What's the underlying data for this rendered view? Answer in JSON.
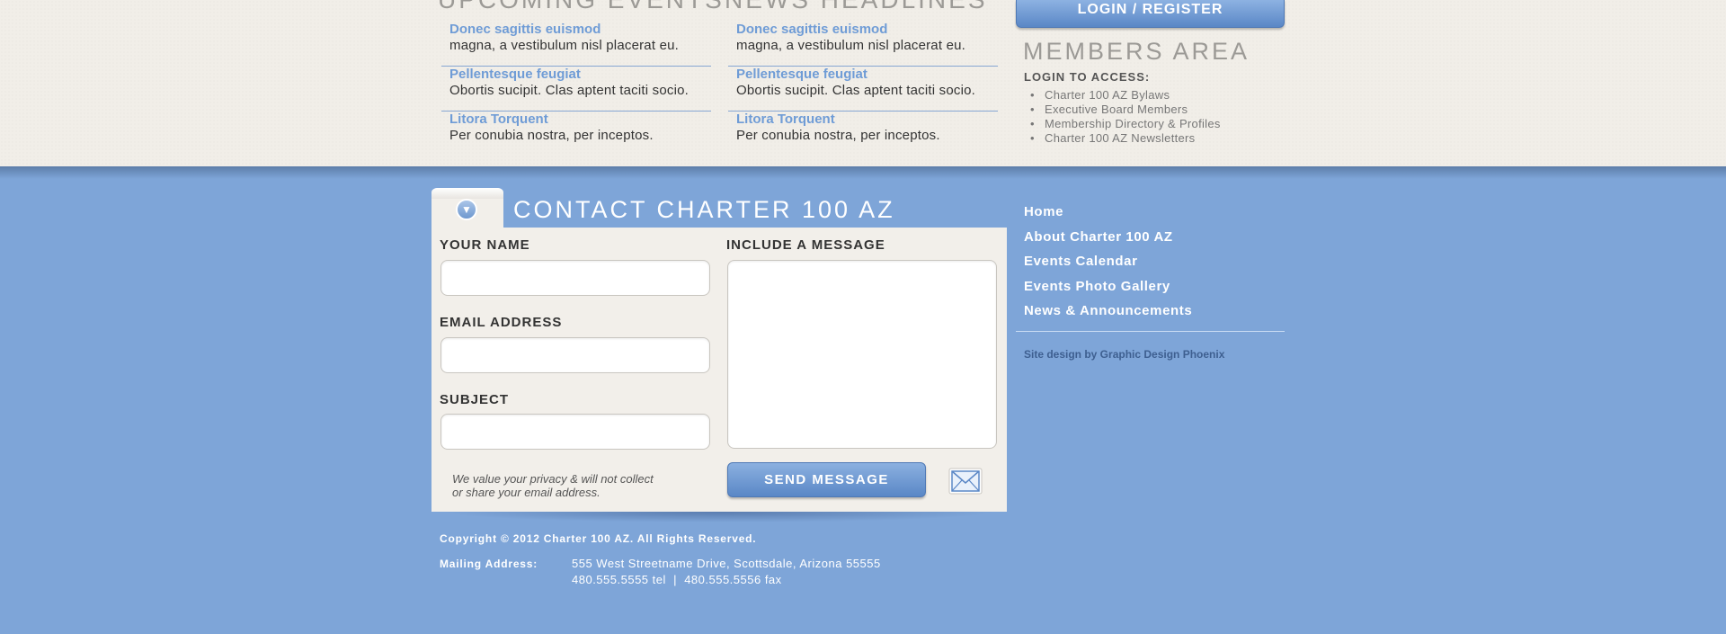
{
  "upcoming_events": {
    "heading": "UPCOMING EVENTS",
    "items": [
      {
        "title": "Donec sagittis euismod",
        "text": "magna, a vestibulum nisl placerat eu."
      },
      {
        "title": "Pellentesque feugiat",
        "text": "Obortis sucipit. Clas aptent taciti socio."
      },
      {
        "title": "Litora Torquent",
        "text": "Per conubia nostra, per inceptos."
      }
    ]
  },
  "news_headlines": {
    "heading": "NEWS HEADLINES",
    "items": [
      {
        "title": "Donec sagittis euismod",
        "text": "magna, a vestibulum nisl placerat eu."
      },
      {
        "title": "Pellentesque feugiat",
        "text": "Obortis sucipit. Clas aptent taciti socio."
      },
      {
        "title": "Litora Torquent",
        "text": "Per conubia nostra, per inceptos."
      }
    ]
  },
  "login_button": "LOGIN / REGISTER",
  "members": {
    "title": "MEMBERS AREA",
    "subtitle": "LOGIN TO ACCESS:",
    "items": [
      "Charter 100 AZ Bylaws",
      "Executive Board Members",
      "Membership Directory & Profiles",
      "Charter 100 AZ Newsletters"
    ]
  },
  "contact": {
    "title": "CONTACT CHARTER 100 AZ",
    "name_label": "YOUR NAME",
    "email_label": "EMAIL ADDRESS",
    "subject_label": "SUBJECT",
    "message_label": "INCLUDE A MESSAGE",
    "privacy_line1": "We value your privacy & will not collect",
    "privacy_line2": "or share your email address.",
    "send_label": "SEND MESSAGE"
  },
  "nav": [
    "Home",
    "About Charter 100 AZ",
    "Events Calendar",
    "Events Photo Gallery",
    "News & Announcements"
  ],
  "credit": "Site design by Graphic Design Phoenix",
  "footer": {
    "copyright": "Copyright © 2012 Charter 100 AZ. All Rights Reserved.",
    "mailing_label": "Mailing Address:",
    "address_line1": "555 West Streetname Drive, Scottsdale, Arizona 55555",
    "address_line2": "480.555.5555 tel  |  480.555.5556 fax"
  },
  "colors": {
    "footer_bg": "#7ea5d8",
    "top_bg": "#f1eee8",
    "link_blue": "#6f9cd6",
    "button_blue": "#5a87c6"
  }
}
